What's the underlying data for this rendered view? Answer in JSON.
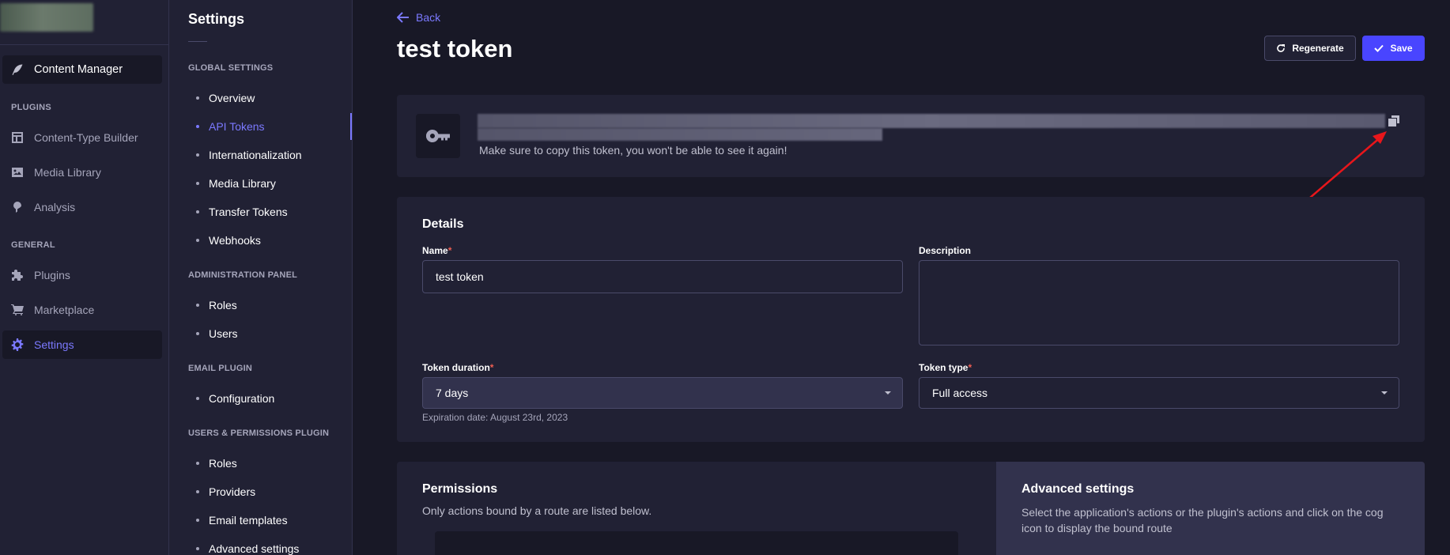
{
  "nav": {
    "content_manager": "Content Manager",
    "sections": {
      "plugins": "PLUGINS",
      "general": "GENERAL"
    },
    "items": {
      "content_type_builder": "Content-Type Builder",
      "media_library": "Media Library",
      "analysis": "Analysis",
      "plugins": "Plugins",
      "marketplace": "Marketplace",
      "settings": "Settings"
    }
  },
  "settings_nav": {
    "title": "Settings",
    "global_settings": {
      "label": "GLOBAL SETTINGS",
      "items": [
        "Overview",
        "API Tokens",
        "Internationalization",
        "Media Library",
        "Transfer Tokens",
        "Webhooks"
      ]
    },
    "administration_panel": {
      "label": "ADMINISTRATION PANEL",
      "items": [
        "Roles",
        "Users"
      ]
    },
    "email_plugin": {
      "label": "EMAIL PLUGIN",
      "items": [
        "Configuration"
      ]
    },
    "users_permissions_plugin": {
      "label": "USERS & PERMISSIONS PLUGIN",
      "items": [
        "Roles",
        "Providers",
        "Email templates",
        "Advanced settings"
      ]
    }
  },
  "header": {
    "back": "Back",
    "title": "test token",
    "regenerate": "Regenerate",
    "save": "Save"
  },
  "token_card": {
    "note": "Make sure to copy this token, you won't be able to see it again!"
  },
  "details": {
    "title": "Details",
    "name_label": "Name",
    "name_value": "test token",
    "description_label": "Description",
    "description_value": "",
    "duration_label": "Token duration",
    "duration_value": "7 days",
    "expiration": "Expiration date: August 23rd, 2023",
    "type_label": "Token type",
    "type_value": "Full access",
    "required_mark": "*"
  },
  "permissions": {
    "title": "Permissions",
    "subtitle": "Only actions bound by a route are listed below."
  },
  "advanced": {
    "title": "Advanced settings",
    "description": "Select the application's actions or the plugin's actions and click on the cog icon to display the bound route"
  },
  "colors": {
    "accent": "#7b79ff",
    "primary_button": "#4945ff",
    "background": "#181826",
    "surface": "#212134",
    "annotation_arrow": "#e8161b"
  }
}
